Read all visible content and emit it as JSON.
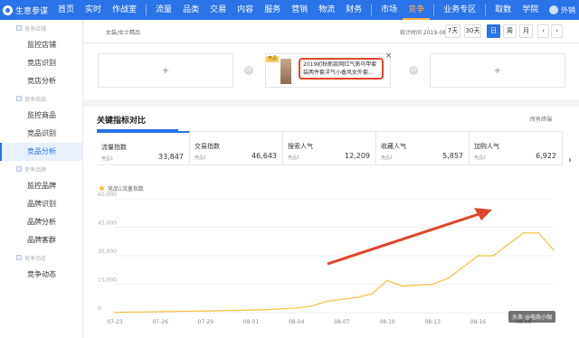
{
  "brand": {
    "name": "生意参谋",
    "logo_icon": "compass-icon"
  },
  "topnav": {
    "items": [
      "首页",
      "实时",
      "作战室",
      "流量",
      "品类",
      "交易",
      "内容",
      "服务",
      "营销",
      "物流",
      "财务",
      "市场",
      "竞争",
      "业务专区",
      "取数",
      "学院"
    ],
    "active": "竞争",
    "user": "外销"
  },
  "sidebar": {
    "section1": "竞争店铺",
    "items1": [
      "监控店铺",
      "竞店识别",
      "竞店分析"
    ],
    "section2": "竞争商品",
    "items2": [
      "监控商品",
      "竞品识别",
      "竞品分析"
    ],
    "section3": "竞争品牌",
    "items3": [
      "监控品牌",
      "品牌识别",
      "品牌分析",
      "品牌客群"
    ],
    "section4": "竞争动态",
    "items4": [
      "竞争动态"
    ],
    "active": "竞品分析"
  },
  "filter": {
    "category": "女装/女士精品",
    "stat_time": "统计时间 2019-08-21",
    "buttons": [
      "7天",
      "30天",
      "日",
      "周",
      "月"
    ],
    "active_button": "日"
  },
  "compare": {
    "slot_plus": "+",
    "vs": "VS",
    "product_tag": "竞品",
    "product_title": "2019初秋新款网红气质马甲套装两件套洋气小香风女外套...",
    "close": "×"
  },
  "panel": {
    "title": "关键指标对比",
    "terminal": "所有终端",
    "metric_sub": "竞品1",
    "metrics": [
      {
        "label": "流量指数",
        "value": "33,847"
      },
      {
        "label": "交易指数",
        "value": "46,643"
      },
      {
        "label": "搜索人气",
        "value": "12,209"
      },
      {
        "label": "收藏人气",
        "value": "5,857"
      },
      {
        "label": "加购人气",
        "value": "6,922"
      }
    ],
    "next": "›",
    "legend": "竞品1流量指数",
    "watermark": "头条 @电商小咖"
  },
  "colors": {
    "accent": "#2a73e8",
    "line": "#f5c242",
    "arrow": "#e0452a"
  },
  "chart_data": {
    "type": "line",
    "title": "",
    "xlabel": "",
    "ylabel": "",
    "x": [
      "07-23",
      "07-24",
      "07-25",
      "07-26",
      "07-27",
      "07-28",
      "07-29",
      "07-30",
      "07-31",
      "08-01",
      "08-02",
      "08-03",
      "08-04",
      "08-05",
      "08-06",
      "08-07",
      "08-08",
      "08-09",
      "08-10",
      "08-11",
      "08-12",
      "08-13",
      "08-14",
      "08-15",
      "08-16",
      "08-17",
      "08-18",
      "08-19",
      "08-20",
      "08-21"
    ],
    "x_ticks": [
      "07-23",
      "07-26",
      "07-29",
      "08-01",
      "08-04",
      "08-07",
      "08-10",
      "08-13",
      "08-16",
      "08-19"
    ],
    "y_ticks": [
      "60,000",
      "45,000",
      "30,000",
      "15,000",
      "0"
    ],
    "ylim": [
      0,
      60000
    ],
    "series": [
      {
        "name": "竞品1流量指数",
        "values": [
          200,
          300,
          400,
          500,
          600,
          800,
          900,
          1000,
          1200,
          1400,
          1600,
          2000,
          2500,
          3500,
          6000,
          7000,
          8000,
          10000,
          17000,
          14000,
          14500,
          15000,
          18000,
          24000,
          30000,
          30000,
          36000,
          42000,
          42000,
          33000
        ]
      }
    ],
    "grid": true,
    "legend_position": "top-left"
  }
}
